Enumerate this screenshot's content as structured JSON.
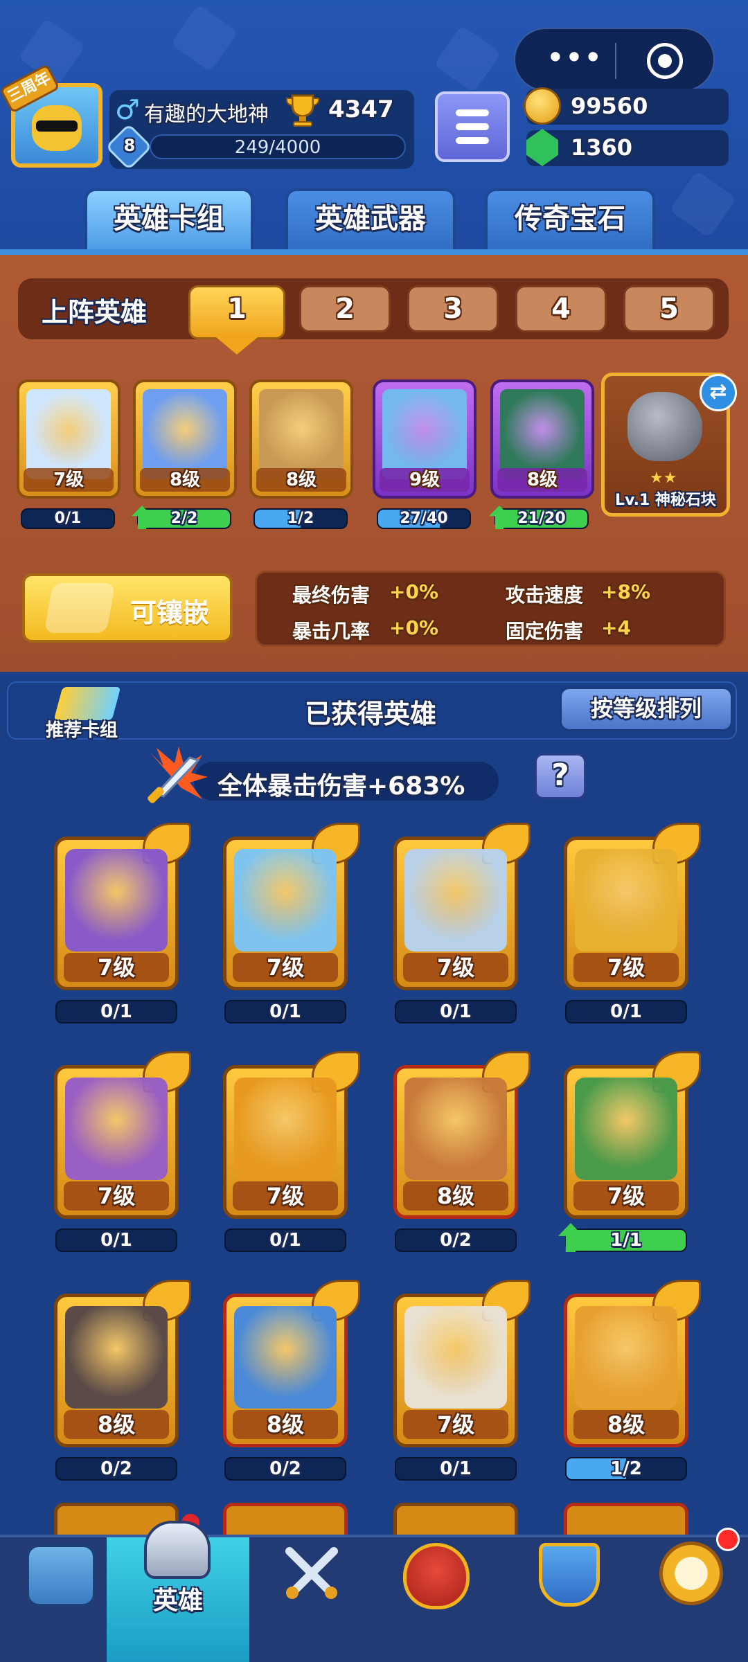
{
  "header": {
    "capsule": {
      "more_glyph": "•••"
    },
    "anniversary_badge": "三周年",
    "player": {
      "name": "有趣的大地神",
      "trophies": "4347",
      "level": "8",
      "xp": "249/4000",
      "xp_fraction": 0.062
    },
    "resources": {
      "gold": "99560",
      "gems": "1360"
    }
  },
  "tabs": [
    {
      "label": "英雄卡组",
      "active": true
    },
    {
      "label": "英雄武器",
      "active": false
    },
    {
      "label": "传奇宝石",
      "active": false
    }
  ],
  "team": {
    "label": "上阵英雄",
    "slots": [
      "1",
      "2",
      "3",
      "4",
      "5"
    ],
    "active_slot": "1",
    "heroes": [
      {
        "level": "7级",
        "progress": "0/1",
        "fill": 0,
        "rarity": "gold",
        "upgradable": false,
        "art_color": "#cfe6ff"
      },
      {
        "level": "8级",
        "progress": "2/2",
        "fill": 1,
        "rarity": "gold",
        "upgradable": true,
        "art_color": "#6e9ef0"
      },
      {
        "level": "8级",
        "progress": "1/2",
        "fill": 0.5,
        "rarity": "gold",
        "upgradable": false,
        "art_color": "#c99a55"
      },
      {
        "level": "9级",
        "progress": "27/40",
        "fill": 0.675,
        "rarity": "purple",
        "upgradable": false,
        "art_color": "#74b8f0"
      },
      {
        "level": "8级",
        "progress": "21/20",
        "fill": 1,
        "rarity": "purple",
        "upgradable": true,
        "art_color": "#2f7a5a"
      }
    ],
    "stone": {
      "label": "Lv.1 神秘石块",
      "stars": "★★",
      "swap_glyph": "⇄"
    },
    "inlay_button": "可镶嵌",
    "stats": [
      {
        "name": "最终伤害",
        "value": "+0%"
      },
      {
        "name": "攻击速度",
        "value": "+8%"
      },
      {
        "name": "暴击几率",
        "value": "+0%"
      },
      {
        "name": "固定伤害",
        "value": "+4"
      }
    ]
  },
  "collection": {
    "recommend_label": "推荐卡组",
    "title": "已获得英雄",
    "sort_button": "按等级排列",
    "crit_bonus": "全体暴击伤害+683%",
    "help_glyph": "?",
    "heroes": [
      {
        "level": "7级",
        "progress": "0/1",
        "fill": 0,
        "upgradable": false,
        "red": false,
        "art_color": "#8a5bc8"
      },
      {
        "level": "7级",
        "progress": "0/1",
        "fill": 0,
        "upgradable": false,
        "red": false,
        "art_color": "#7fc4ee"
      },
      {
        "level": "7级",
        "progress": "0/1",
        "fill": 0,
        "upgradable": false,
        "red": false,
        "art_color": "#b8d0e8"
      },
      {
        "level": "7级",
        "progress": "0/1",
        "fill": 0,
        "upgradable": false,
        "red": false,
        "art_color": "#e8b030"
      },
      {
        "level": "7级",
        "progress": "0/1",
        "fill": 0,
        "upgradable": false,
        "red": false,
        "art_color": "#9a5fc2"
      },
      {
        "level": "7级",
        "progress": "0/1",
        "fill": 0,
        "upgradable": false,
        "red": false,
        "art_color": "#e89a20"
      },
      {
        "level": "8级",
        "progress": "0/2",
        "fill": 0,
        "upgradable": false,
        "red": true,
        "art_color": "#c97a3a"
      },
      {
        "level": "7级",
        "progress": "1/1",
        "fill": 1,
        "upgradable": true,
        "red": false,
        "art_color": "#4a9a4a"
      },
      {
        "level": "8级",
        "progress": "0/2",
        "fill": 0,
        "upgradable": false,
        "red": false,
        "art_color": "#5a4a48"
      },
      {
        "level": "8级",
        "progress": "0/2",
        "fill": 0,
        "upgradable": false,
        "red": true,
        "art_color": "#4a8ad8"
      },
      {
        "level": "7级",
        "progress": "0/1",
        "fill": 0,
        "upgradable": false,
        "red": false,
        "art_color": "#e8e0d0"
      },
      {
        "level": "8级",
        "progress": "1/2",
        "fill": 0.5,
        "upgradable": false,
        "red": true,
        "art_color": "#e8a030"
      }
    ]
  },
  "nav": {
    "items": [
      {
        "id": "chest",
        "label": ""
      },
      {
        "id": "heroes",
        "label": "英雄",
        "active": true
      },
      {
        "id": "battle",
        "label": ""
      },
      {
        "id": "crown",
        "label": ""
      },
      {
        "id": "social",
        "label": ""
      },
      {
        "id": "compass",
        "label": ""
      }
    ]
  },
  "colors": {
    "background": "#1a3f86",
    "team_panel": "#b05a35",
    "accent_gold": "#ffd34d",
    "progress_green": "#3fcf4e",
    "progress_blue": "#4aa8f0"
  }
}
